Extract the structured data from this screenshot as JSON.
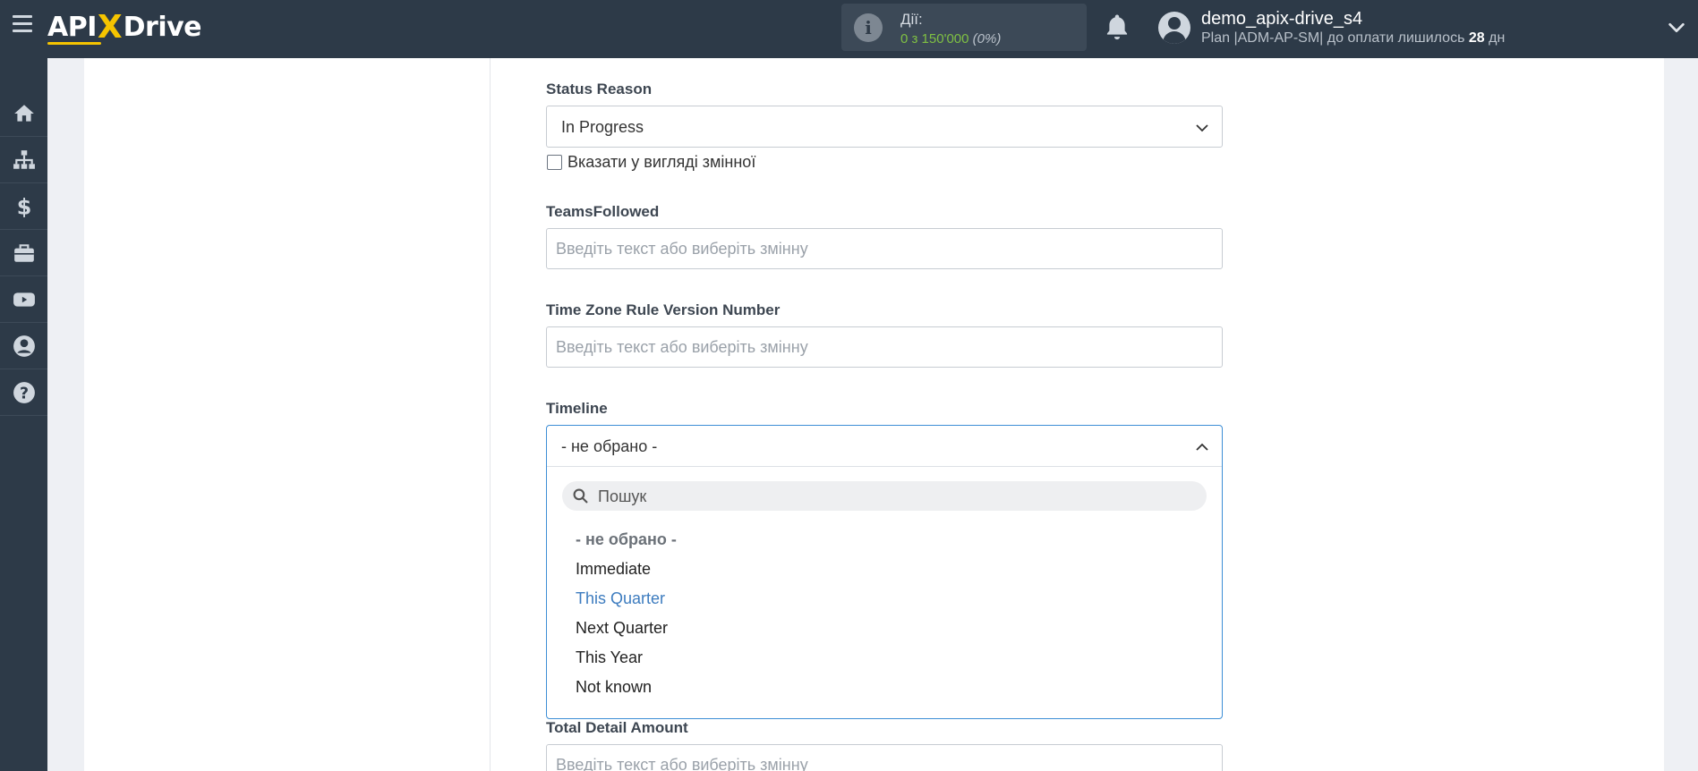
{
  "brand": {
    "logo_left": "API",
    "logo_x": "X",
    "logo_right": "Drive"
  },
  "header": {
    "actions_label": "Дії:",
    "actions_value": "0 з 150'000",
    "actions_pct": "(0%)",
    "user_name": "demo_apix-drive_s4",
    "plan_prefix": "Plan |ADM-AP-SM| до оплати лишилось ",
    "plan_days": "28",
    "plan_suffix": " дн"
  },
  "sidebar": {
    "items": [
      {
        "icon": "home-icon"
      },
      {
        "icon": "sitemap-icon"
      },
      {
        "icon": "dollar-icon"
      },
      {
        "icon": "briefcase-icon"
      },
      {
        "icon": "youtube-icon"
      },
      {
        "icon": "user-circle-icon"
      },
      {
        "icon": "help-icon"
      }
    ]
  },
  "form": {
    "status_reason": {
      "label": "Status Reason",
      "value": "In Progress",
      "checkbox_label": "Вказати у вигляді змінної"
    },
    "teams_followed": {
      "label": "TeamsFollowed",
      "placeholder": "Введіть текст або виберіть змінну"
    },
    "tz_rule": {
      "label": "Time Zone Rule Version Number",
      "placeholder": "Введіть текст або виберіть змінну"
    },
    "timeline": {
      "label": "Timeline",
      "value": "- не обрано -",
      "search_placeholder": "Пошук",
      "options": [
        "- не обрано -",
        "Immediate",
        "This Quarter",
        "Next Quarter",
        "This Year",
        "Not known"
      ],
      "highlighted_option": "This Quarter"
    },
    "total_detail_amount": {
      "label": "Total Detail Amount",
      "placeholder": "Введіть текст або виберіть змінну"
    }
  },
  "colors": {
    "topbar": "#2d3a48",
    "accent_yellow": "#f5c400",
    "actions_green": "#7fc043",
    "dropdown_border": "#3d8ed6",
    "highlight_option": "#3d7cbf"
  }
}
